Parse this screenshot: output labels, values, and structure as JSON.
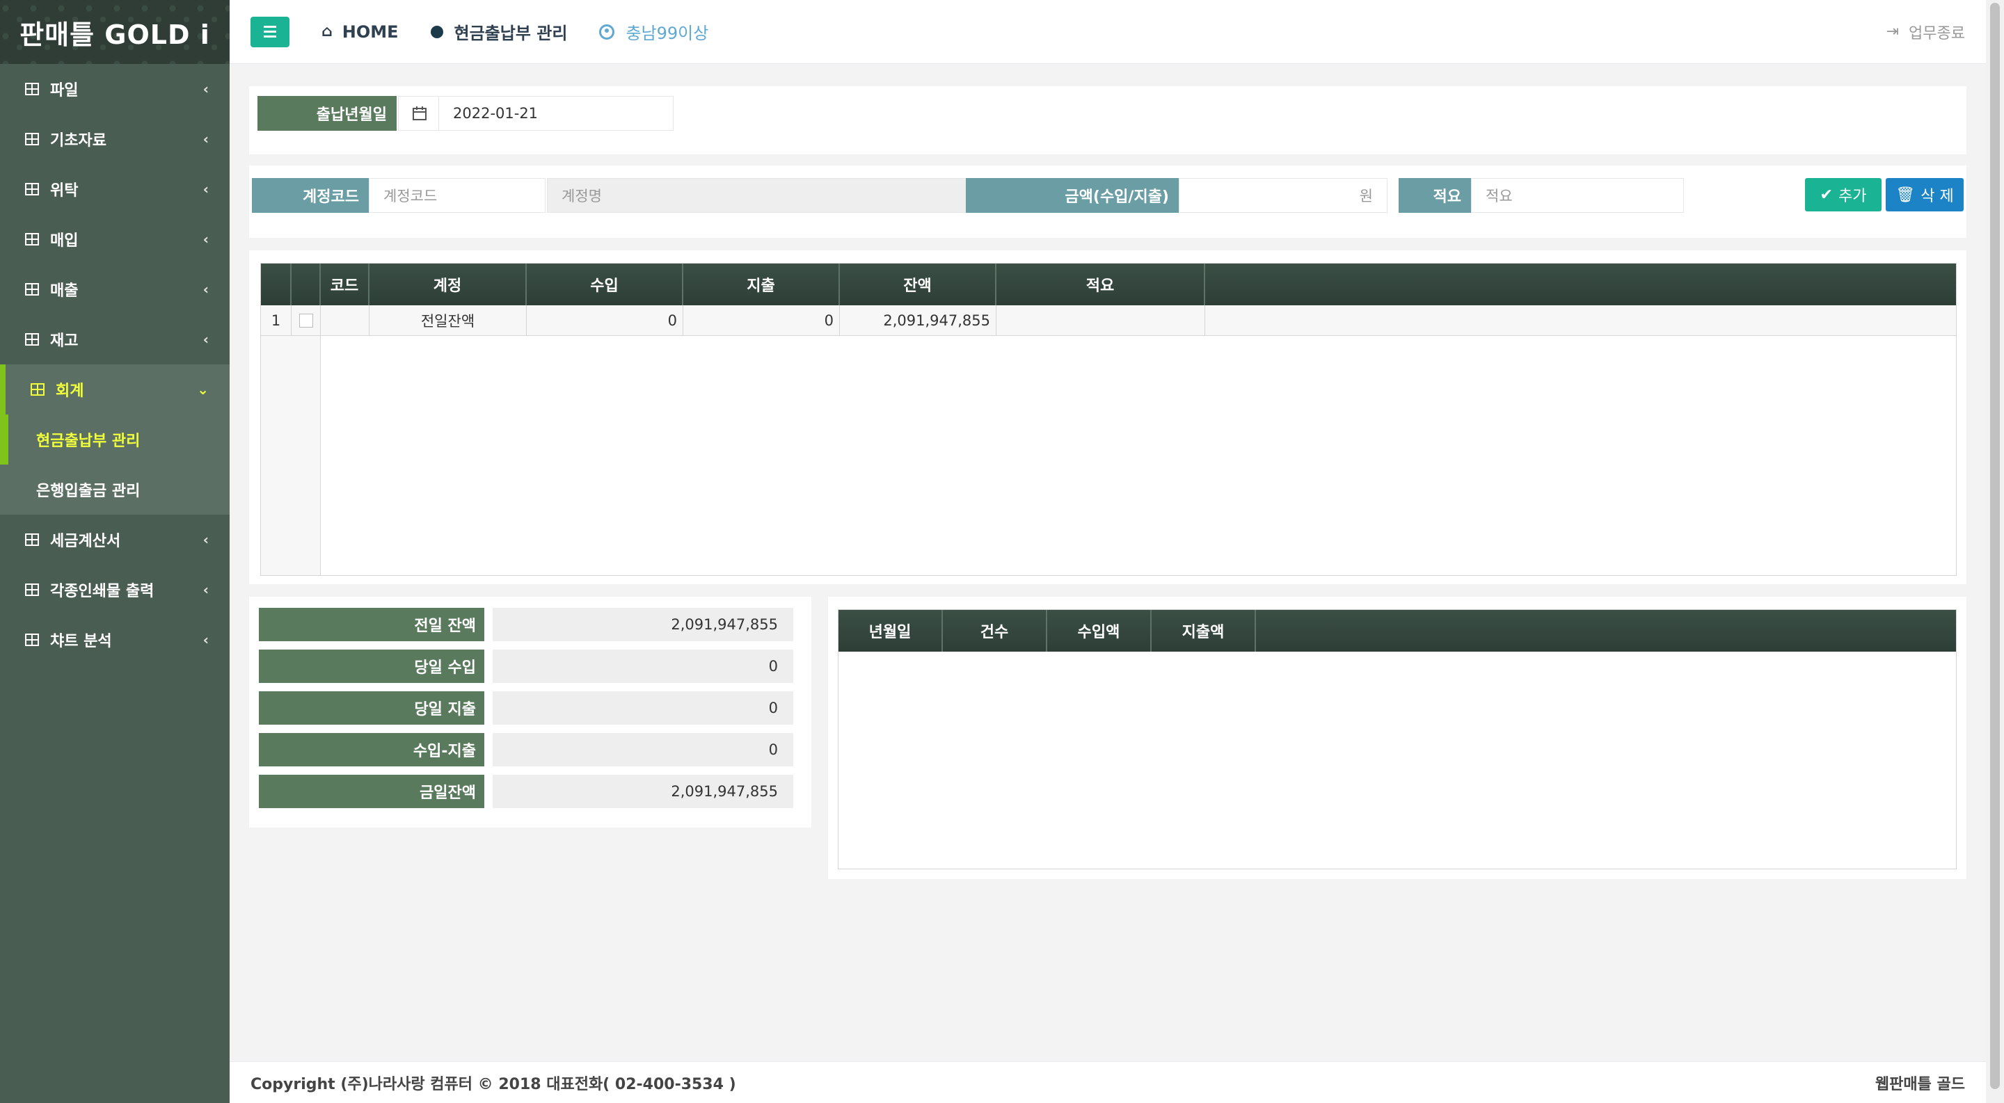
{
  "brand": "판매틀 GOLD i",
  "sidebar": {
    "items": [
      {
        "label": "파일"
      },
      {
        "label": "기초자료"
      },
      {
        "label": "위탁"
      },
      {
        "label": "매입"
      },
      {
        "label": "매출"
      },
      {
        "label": "재고"
      },
      {
        "label": "회계"
      },
      {
        "label": "세금계산서"
      },
      {
        "label": "각종인쇄물 출력"
      },
      {
        "label": "챠트 분석"
      }
    ],
    "subitems": [
      {
        "label": "현금출납부 관리"
      },
      {
        "label": "은행입출금 관리"
      }
    ]
  },
  "topbar": {
    "home": "HOME",
    "page": "현금출납부 관리",
    "user": "충남99이상",
    "logout": "업무종료"
  },
  "date_filter": {
    "label": "출납년월일",
    "value": "2022-01-21"
  },
  "entry": {
    "account_code_label": "계정코드",
    "account_code_placeholder": "계정코드",
    "account_name_placeholder": "계정명",
    "amount_label": "금액(수입/지출)",
    "amount_unit": "원",
    "memo_label": "적요",
    "memo_placeholder": "적요",
    "add_button": "추가",
    "delete_button": "삭 제"
  },
  "main_table": {
    "headers": [
      "코드",
      "계정",
      "수입",
      "지출",
      "잔액",
      "적요"
    ],
    "rows": [
      {
        "no": "1",
        "code": "",
        "account": "전일잔액",
        "income": "0",
        "expense": "0",
        "balance": "2,091,947,855",
        "memo": ""
      }
    ]
  },
  "summary": [
    {
      "label": "전일 잔액",
      "value": "2,091,947,855"
    },
    {
      "label": "당일 수입",
      "value": "0"
    },
    {
      "label": "당일 지출",
      "value": "0"
    },
    {
      "label": "수입-지출",
      "value": "0"
    },
    {
      "label": "금일잔액",
      "value": "2,091,947,855"
    }
  ],
  "daily_table": {
    "headers": [
      "년월일",
      "건수",
      "수입액",
      "지출액"
    ]
  },
  "footer": {
    "copyright": "Copyright (주)나라사랑 컴퓨터 © 2018 대표전화( 02-400-3534 )",
    "right": "웹판매틀 골드"
  },
  "colors": {
    "sidebar": "#4a5d53",
    "accent_green": "#1ab394",
    "accent_blue": "#1c84c6",
    "label_green": "#5a7a5d",
    "label_teal": "#6a9ea4",
    "active_yellow": "#f1ff3a"
  }
}
